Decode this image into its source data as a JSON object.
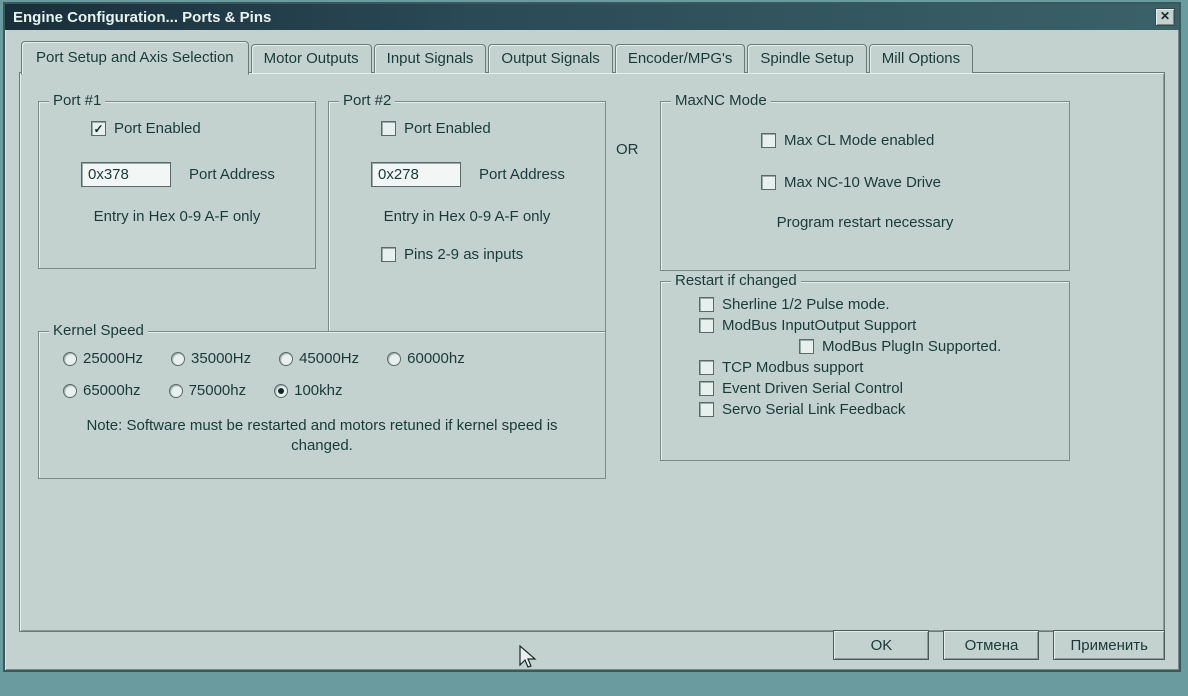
{
  "window": {
    "title": "Engine Configuration... Ports & Pins"
  },
  "tabs": [
    {
      "label": "Port Setup and Axis Selection",
      "active": true
    },
    {
      "label": "Motor Outputs",
      "active": false
    },
    {
      "label": "Input Signals",
      "active": false
    },
    {
      "label": "Output Signals",
      "active": false
    },
    {
      "label": "Encoder/MPG's",
      "active": false
    },
    {
      "label": "Spindle Setup",
      "active": false
    },
    {
      "label": "Mill Options",
      "active": false
    }
  ],
  "port1": {
    "legend": "Port #1",
    "enabled_label": "Port Enabled",
    "enabled": true,
    "address": "0x378",
    "address_label": "Port Address",
    "hex_hint": "Entry in Hex 0-9 A-F only"
  },
  "port2": {
    "legend": "Port #2",
    "enabled_label": "Port Enabled",
    "enabled": false,
    "address": "0x278",
    "address_label": "Port Address",
    "hex_hint": "Entry in Hex 0-9 A-F only",
    "pins_inputs_label": "Pins 2-9 as inputs",
    "pins_inputs": false
  },
  "or_label": "OR",
  "maxnc": {
    "legend": "MaxNC Mode",
    "cl_mode_label": "Max CL Mode enabled",
    "cl_mode": false,
    "wave_drive_label": "Max NC-10 Wave Drive",
    "wave_drive": false,
    "restart_note": "Program restart necessary"
  },
  "restart": {
    "legend": "Restart if changed",
    "sherline_label": "Sherline 1/2 Pulse mode.",
    "sherline": false,
    "modbus_io_label": "ModBus InputOutput Support",
    "modbus_io": false,
    "modbus_plugin_label": "ModBus PlugIn Supported.",
    "modbus_plugin": false,
    "tcp_modbus_label": "TCP Modbus support",
    "tcp_modbus": false,
    "event_serial_label": "Event Driven Serial Control",
    "event_serial": false,
    "servo_serial_label": "Servo Serial Link Feedback",
    "servo_serial": false
  },
  "kernel": {
    "legend": "Kernel Speed",
    "options": [
      {
        "label": "25000Hz",
        "checked": false
      },
      {
        "label": "35000Hz",
        "checked": false
      },
      {
        "label": "45000Hz",
        "checked": false
      },
      {
        "label": "60000hz",
        "checked": false
      },
      {
        "label": "65000hz",
        "checked": false
      },
      {
        "label": "75000hz",
        "checked": false
      },
      {
        "label": "100khz",
        "checked": true
      }
    ],
    "note": "Note: Software must be restarted and motors retuned if kernel speed is changed."
  },
  "buttons": {
    "ok": "OK",
    "cancel": "Отмена",
    "apply": "Применить"
  }
}
